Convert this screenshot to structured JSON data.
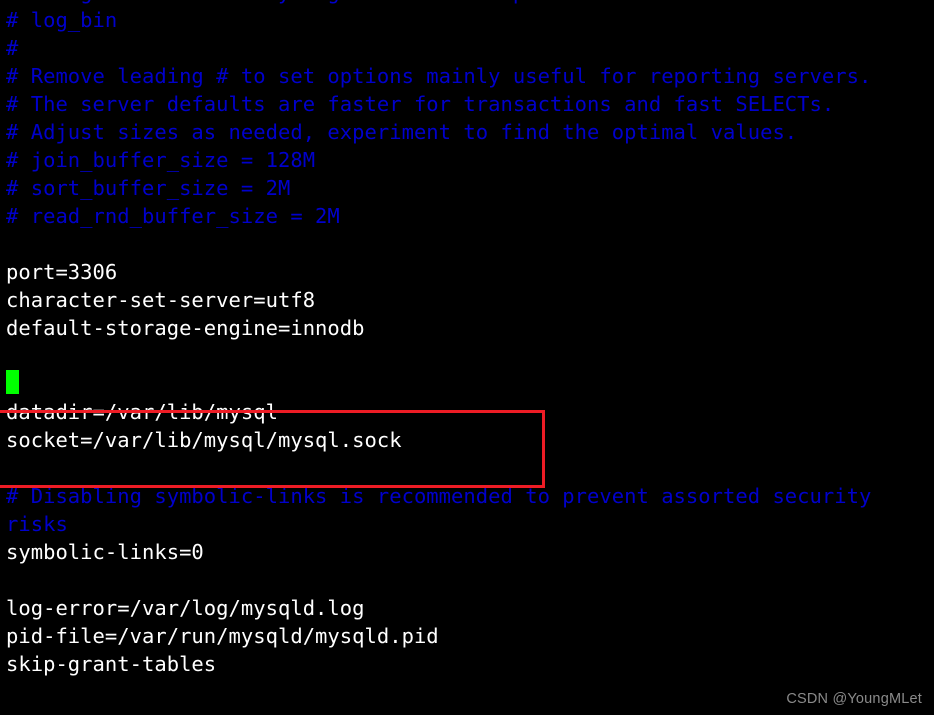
{
  "terminal": {
    "background_color": "#000000",
    "comment_color": "#0000CC",
    "text_color": "#FFFFFF",
    "cursor_color": "#00FF00",
    "annotation_color": "#EE1C25",
    "lines": [
      {
        "text": "# changes to the binary log between backups.",
        "kind": "comment"
      },
      {
        "text": "# log_bin",
        "kind": "comment"
      },
      {
        "text": "#",
        "kind": "comment"
      },
      {
        "text": "# Remove leading # to set options mainly useful for reporting servers.",
        "kind": "comment"
      },
      {
        "text": "# The server defaults are faster for transactions and fast SELECTs.",
        "kind": "comment"
      },
      {
        "text": "# Adjust sizes as needed, experiment to find the optimal values.",
        "kind": "comment"
      },
      {
        "text": "# join_buffer_size = 128M",
        "kind": "comment"
      },
      {
        "text": "# sort_buffer_size = 2M",
        "kind": "comment"
      },
      {
        "text": "# read_rnd_buffer_size = 2M",
        "kind": "comment"
      },
      {
        "text": "",
        "kind": "blank"
      },
      {
        "text": "port=3306",
        "kind": "plain"
      },
      {
        "text": "character-set-server=utf8",
        "kind": "plain"
      },
      {
        "text": "default-storage-engine=innodb",
        "kind": "plain"
      },
      {
        "text": "",
        "kind": "blank"
      },
      {
        "text": "",
        "kind": "blank"
      },
      {
        "text": "datadir=/var/lib/mysql",
        "kind": "plain"
      },
      {
        "text": "socket=/var/lib/mysql/mysql.sock",
        "kind": "plain"
      },
      {
        "text": "",
        "kind": "blank"
      },
      {
        "text": "# Disabling symbolic-links is recommended to prevent assorted security",
        "kind": "comment"
      },
      {
        "text": "risks",
        "kind": "comment"
      },
      {
        "text": "symbolic-links=0",
        "kind": "plain"
      },
      {
        "text": "",
        "kind": "blank"
      },
      {
        "text": "log-error=/var/log/mysqld.log",
        "kind": "plain"
      },
      {
        "text": "pid-file=/var/run/mysqld/mysqld.pid",
        "kind": "plain"
      },
      {
        "text": "skip-grant-tables",
        "kind": "plain"
      }
    ]
  },
  "cursor": {
    "name": "text-cursor",
    "line_index": 13,
    "column": 0
  },
  "annotation": {
    "name": "red-highlight-rectangle",
    "highlighted_lines": [
      "datadir=/var/lib/mysql",
      "socket=/var/lib/mysql/mysql.sock"
    ]
  },
  "watermark": {
    "text": "CSDN @YoungMLet"
  }
}
